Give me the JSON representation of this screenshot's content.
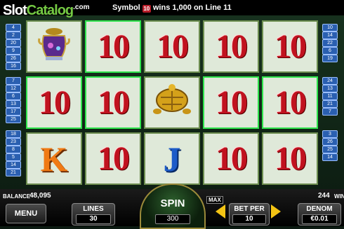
{
  "brand": {
    "part1": "Slot",
    "part2": "Catalog",
    "part3": ".com"
  },
  "message": {
    "prefix": "Symbol",
    "symbol_text": "10",
    "suffix": "wins 1,000 on Line 11"
  },
  "left_lines": [
    "4",
    "2",
    "20",
    "9",
    "26",
    "16",
    "7",
    "12",
    "6",
    "13",
    "17",
    "25",
    "18",
    "23",
    "8",
    "5",
    "14",
    "21"
  ],
  "right_lines": [
    "10",
    "14",
    "22",
    "6",
    "19",
    "24",
    "13",
    "11",
    "21",
    "7",
    "3",
    "26",
    "25",
    "14"
  ],
  "reels": [
    [
      "vase",
      "10",
      "K"
    ],
    [
      "10",
      "10",
      "10"
    ],
    [
      "10",
      "turtle",
      "J"
    ],
    [
      "10",
      "10",
      "10"
    ],
    [
      "10",
      "10",
      "10"
    ]
  ],
  "highlighted": [
    "0-1",
    "1-0",
    "1-1",
    "3-1",
    "4-1"
  ],
  "panel": {
    "balance_label": "BALANCE",
    "balance_value": "48,095",
    "win_value": "244",
    "win_label": "WIN",
    "menu_label": "MENU",
    "lines_label": "LINES",
    "lines_value": "30",
    "spin_label": "SPIN",
    "spin_value": "300",
    "max_label": "MAX",
    "bet_label": "BET PER",
    "bet_value": "10",
    "denom_label": "DENOM",
    "denom_value": "€0.01"
  },
  "colors": {
    "accent": "#f3c414",
    "highlight": "#2ee34b",
    "line_badge": "#2a5fb0"
  }
}
